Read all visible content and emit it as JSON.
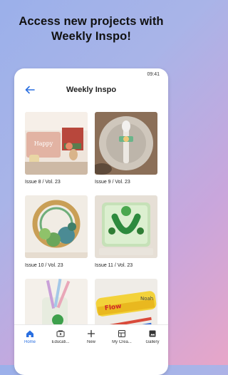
{
  "headline": {
    "line1": "Access new projects with",
    "line2": "Weekly Inspo!"
  },
  "status": {
    "time": "09:41"
  },
  "appbar": {
    "title": "Weekly Inspo"
  },
  "issues": [
    {
      "label": "Issue 8 / Vol. 23"
    },
    {
      "label": "Issue 9 / Vol. 23"
    },
    {
      "label": "Issue 10 / Vol. 23"
    },
    {
      "label": "Issue 11 / Vol. 23"
    },
    {
      "label": ""
    },
    {
      "label": ""
    }
  ],
  "nav": {
    "items": [
      {
        "label": "Home",
        "icon": "home-icon",
        "active": true
      },
      {
        "label": "Educati...",
        "icon": "education-icon",
        "active": false
      },
      {
        "label": "New",
        "icon": "plus-icon",
        "active": false
      },
      {
        "label": "My Crea...",
        "icon": "my-creations-icon",
        "active": false
      },
      {
        "label": "Gallery",
        "icon": "gallery-icon",
        "active": false
      }
    ]
  },
  "colors": {
    "accent": "#2a6fe0"
  }
}
